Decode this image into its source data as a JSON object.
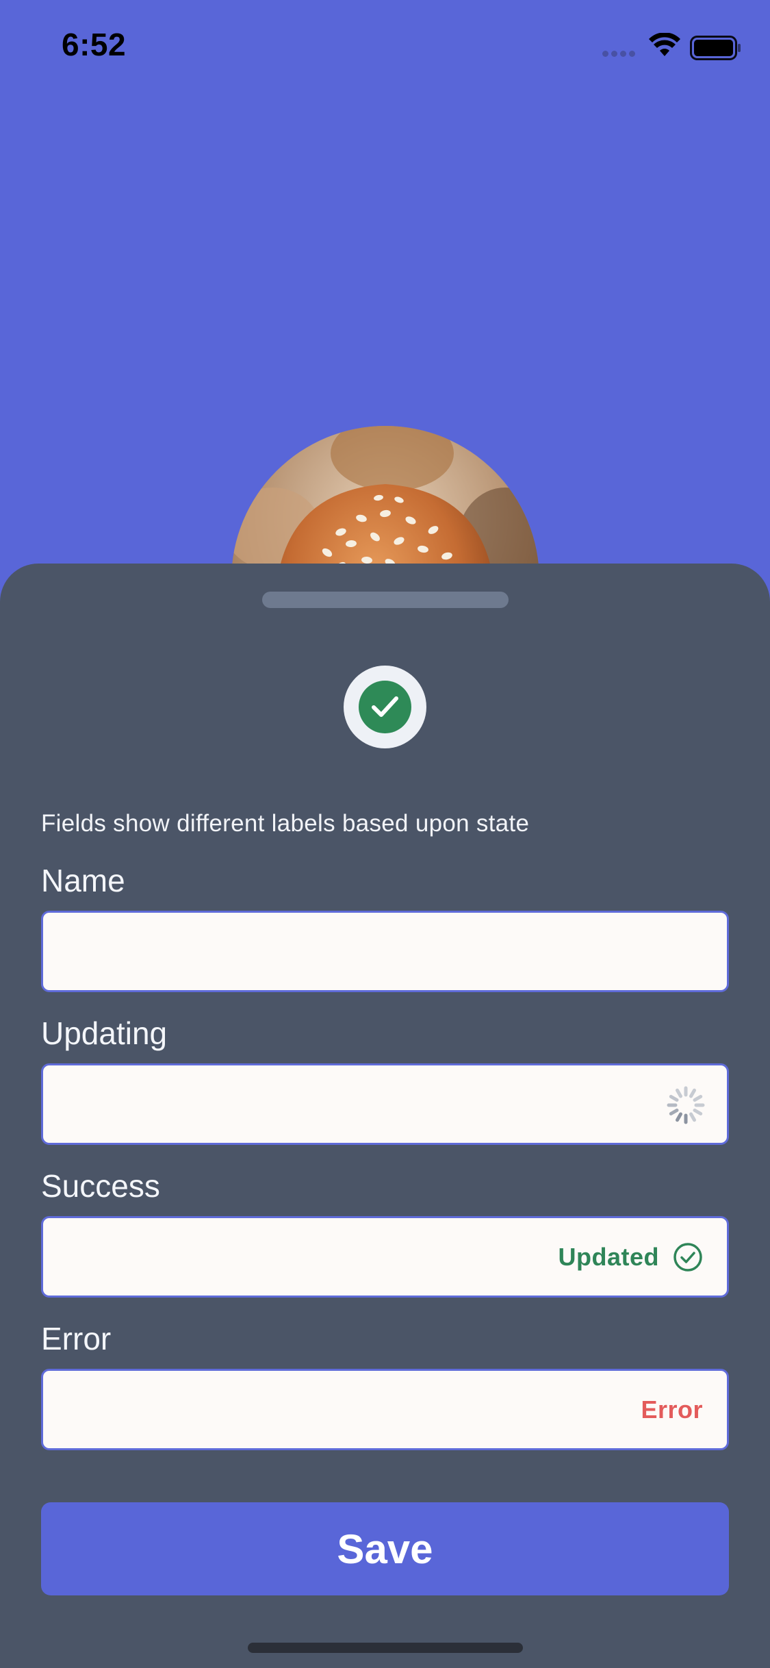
{
  "status_bar": {
    "time": "6:52"
  },
  "sheet": {
    "description": "Fields show different labels based upon state",
    "status_icon": "checkmark-circle-icon",
    "fields": [
      {
        "label": "Name",
        "value": "",
        "state": "idle"
      },
      {
        "label": "Updating",
        "value": "",
        "state": "loading",
        "indicator_icon": "spinner-icon"
      },
      {
        "label": "Success",
        "value": "",
        "state": "success",
        "status_text": "Updated",
        "indicator_icon": "check-circle-outline-icon"
      },
      {
        "label": "Error",
        "value": "",
        "state": "error",
        "status_text": "Error"
      }
    ],
    "save_label": "Save"
  },
  "colors": {
    "background": "#5966d8",
    "sheet": "#4b5567",
    "accent": "#5966d8",
    "success": "#2f8558",
    "error": "#e35b5b",
    "field_background": "#fdfaf8"
  }
}
